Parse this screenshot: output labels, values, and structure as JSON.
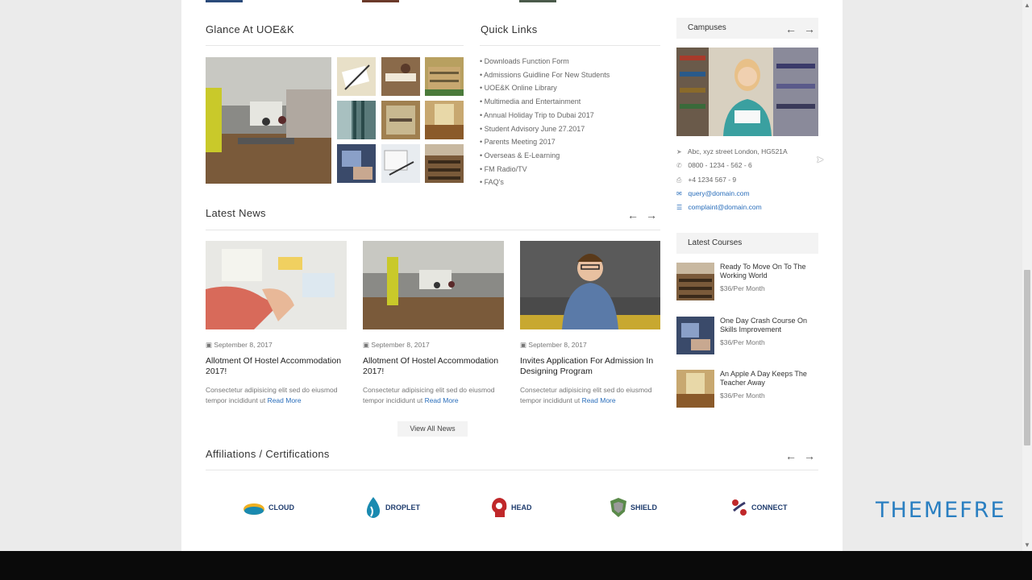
{
  "glance": {
    "title": "Glance At UOE&K"
  },
  "quick_links": {
    "title": "Quick Links",
    "items": [
      "Downloads Function Form",
      "Admissions Guidline For New Students",
      "UOE&K Online Library",
      "Multimedia and Entertainment",
      "Annual Holiday Trip to Dubai 2017",
      "Student Advisory June 27.2017",
      "Parents Meeting 2017",
      "Overseas & E-Learning",
      "FM Radio/TV",
      "FAQ's"
    ]
  },
  "campuses": {
    "title": "Campuses",
    "address": "Abc, xyz street London, HG521A",
    "phone": "0800 - 1234 - 562 - 6",
    "fax": "+4 1234 567 - 9",
    "email": "query@domain.com",
    "complaint": "complaint@domain.com"
  },
  "latest_news": {
    "title": "Latest News",
    "items": [
      {
        "date": "September 8, 2017",
        "title": "Allotment Of Hostel Accommodation 2017!",
        "excerpt": "Consectetur adipisicing elit sed do eiusmod tempor incididunt ut",
        "more": "Read More"
      },
      {
        "date": "September 8, 2017",
        "title": "Allotment Of Hostel Accommodation 2017!",
        "excerpt": "Consectetur adipisicing elit sed do eiusmod tempor incididunt ut",
        "more": "Read More"
      },
      {
        "date": "September 8, 2017",
        "title": "Invites Application For Admission In Designing Program",
        "excerpt": "Consectetur adipisicing elit sed do eiusmod tempor incididunt ut",
        "more": "Read More"
      }
    ],
    "view_all": "View All News"
  },
  "latest_courses": {
    "title": "Latest Courses",
    "items": [
      {
        "title": "Ready To Move On To The Working World",
        "price": "$36/Per Month"
      },
      {
        "title": "One Day Crash Course On Skills Improvement",
        "price": "$36/Per Month"
      },
      {
        "title": "An Apple A Day Keeps The Teacher Away",
        "price": "$36/Per Month"
      }
    ]
  },
  "affiliations": {
    "title": "Affiliations / Certifications",
    "logos": [
      {
        "name": "CLOUD",
        "color": "#1f3c6e"
      },
      {
        "name": "DROPLET",
        "color": "#1f3c6e"
      },
      {
        "name": "HEAD",
        "color": "#1f3c6e"
      },
      {
        "name": "SHIELD",
        "color": "#1f3c6e"
      },
      {
        "name": "CONNECT",
        "color": "#1f3c6e"
      }
    ]
  },
  "watermark": {
    "text": "THEMEFRE"
  },
  "colors": {
    "link": "#2a6ebb",
    "accent_bg": "#f3f3f3"
  }
}
